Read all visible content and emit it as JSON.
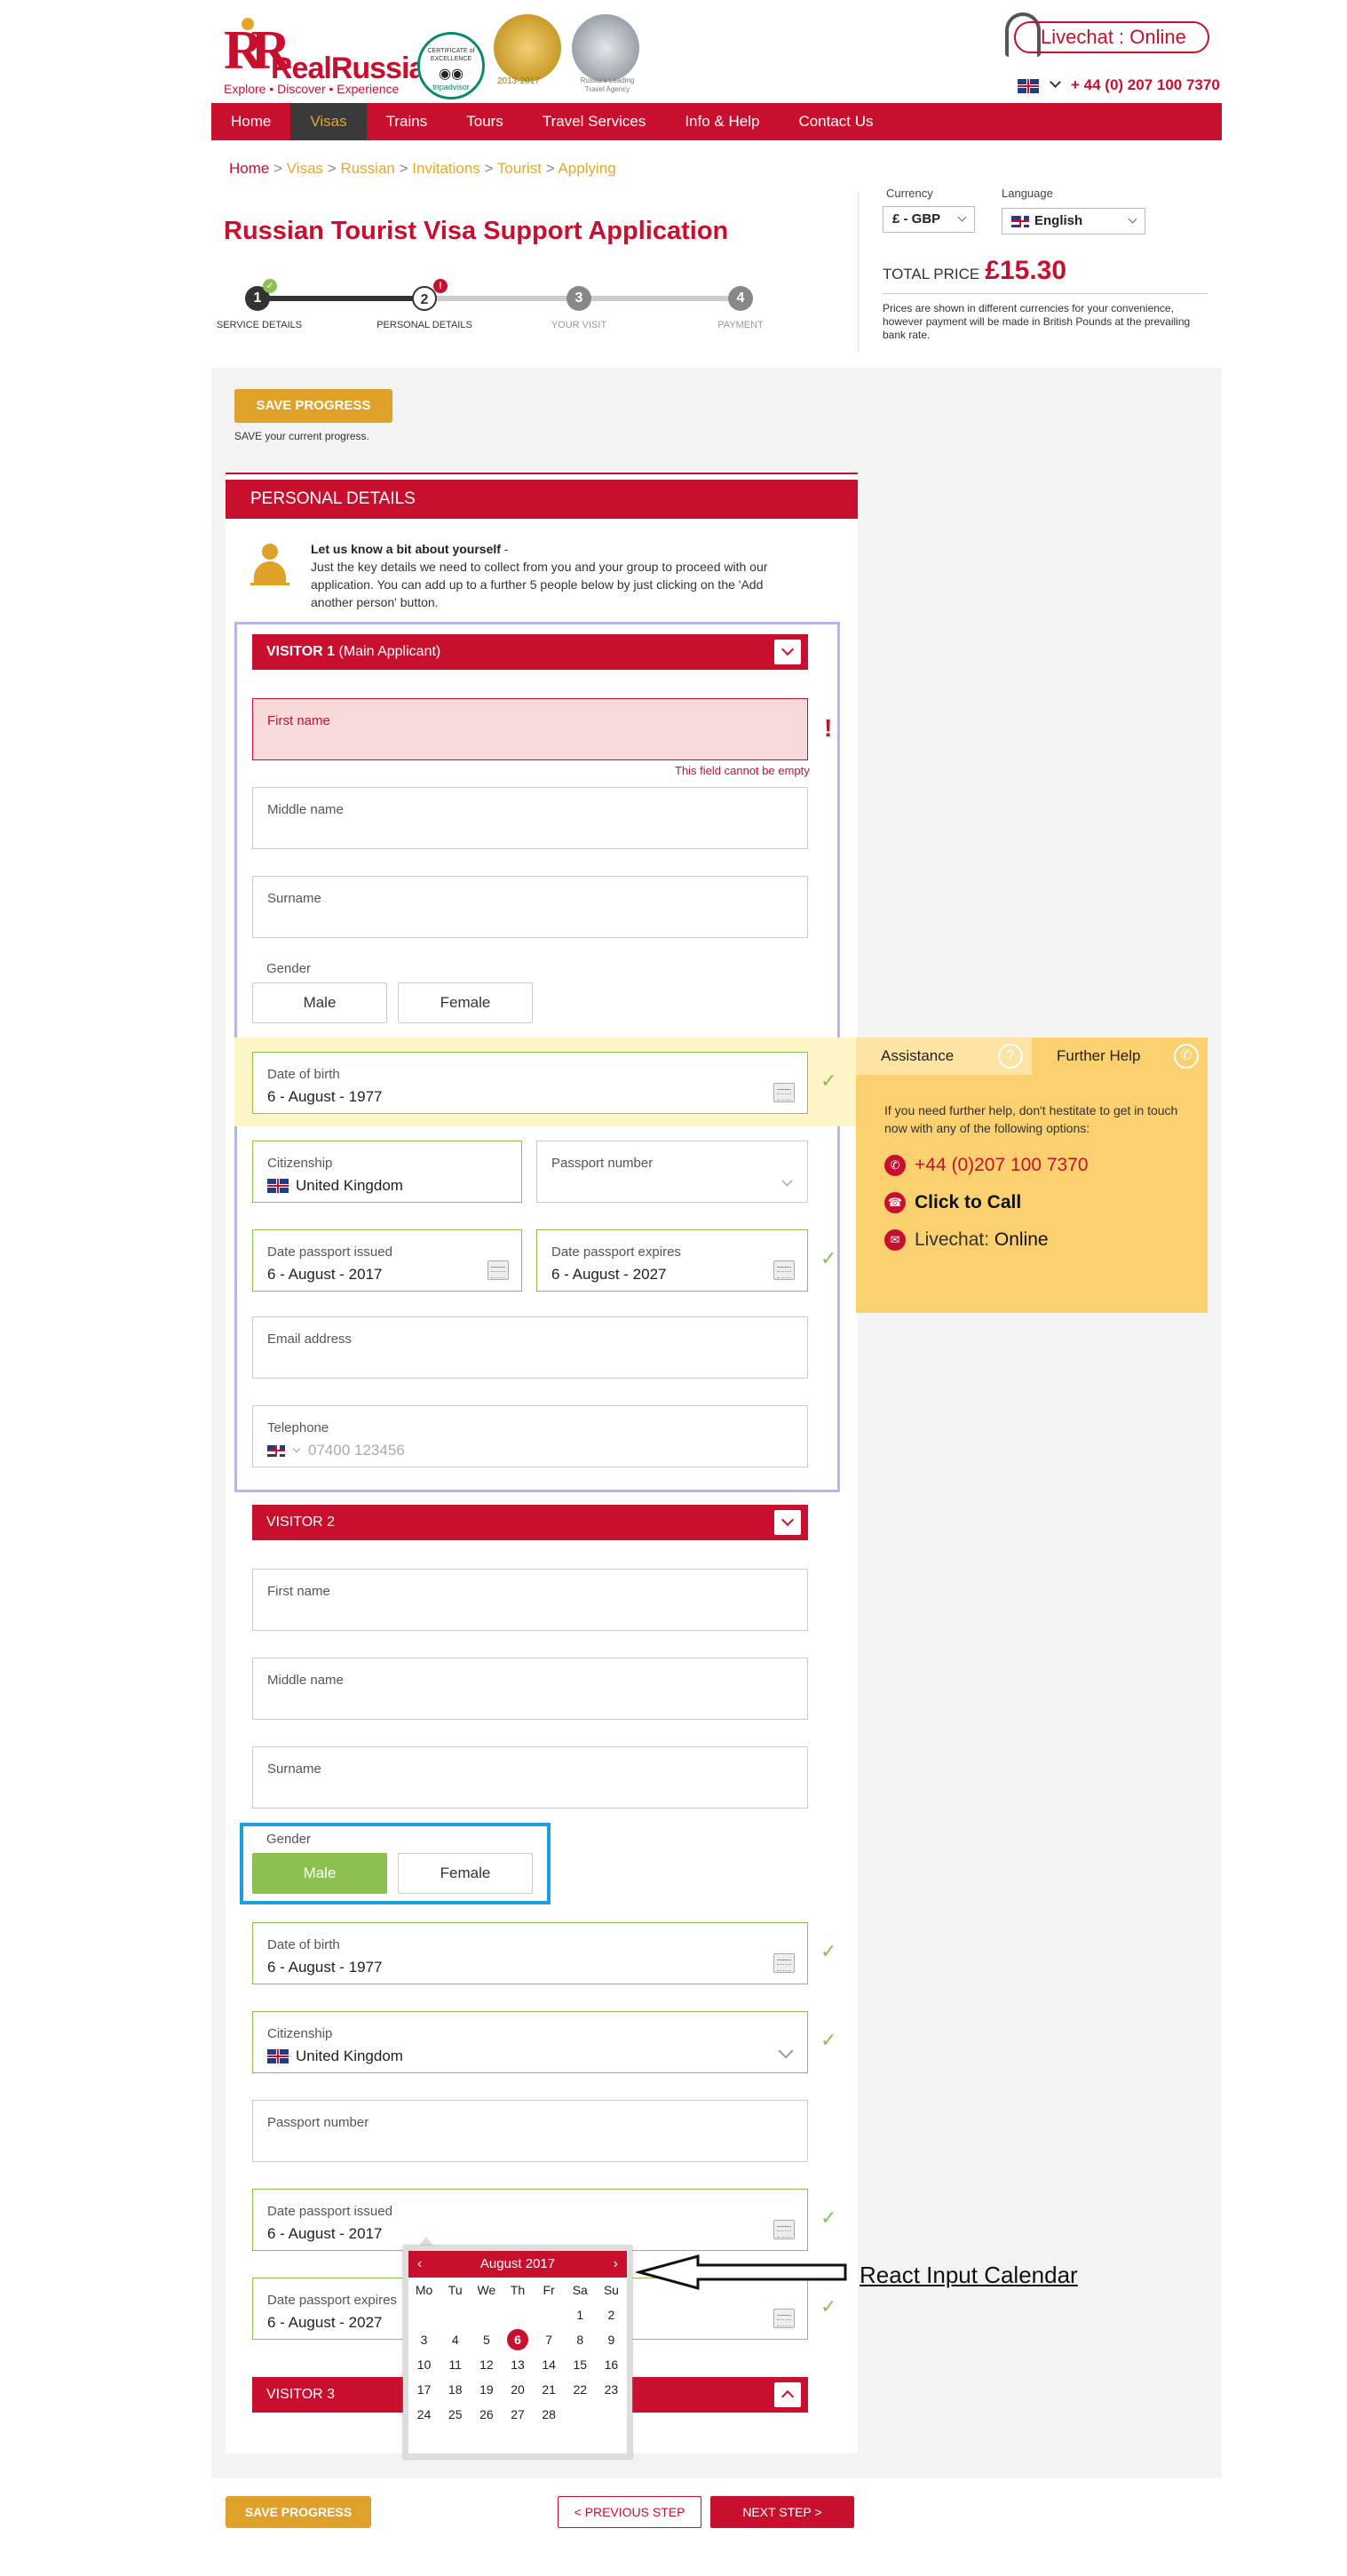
{
  "header": {
    "logo_mark": "RR",
    "logo_name": "RealRussia",
    "logo_tagline": "Explore • Discover • Experience",
    "badge_tripadvisor_top": "CERTIFICATE of EXCELLENCE",
    "badge_tripadvisor_brand": "tripadvisor",
    "badge_award1": "2013-2017",
    "badge_award2": "Russia's Leading Travel Agency",
    "livechat": "Livechat : Online",
    "phone": "+ 44 (0) 207 100 7370"
  },
  "nav": {
    "items": [
      "Home",
      "Visas",
      "Trains",
      "Tours",
      "Travel Services",
      "Info & Help",
      "Contact Us"
    ],
    "active": "Visas"
  },
  "breadcrumb": {
    "home": "Home",
    "sep": ">",
    "items": [
      "Visas",
      "Russian",
      "Invitations",
      "Tourist",
      "Applying"
    ]
  },
  "page": {
    "title": "Russian Tourist Visa Support Application"
  },
  "steps": [
    {
      "num": "1",
      "label": "SERVICE DETAILS",
      "state": "done"
    },
    {
      "num": "2",
      "label": "PERSONAL DETAILS",
      "state": "current",
      "alert": "!"
    },
    {
      "num": "3",
      "label": "YOUR VISIT",
      "state": "todo"
    },
    {
      "num": "4",
      "label": "PAYMENT",
      "state": "todo"
    }
  ],
  "pricing": {
    "currency_label": "Currency",
    "currency_value": "£ - GBP",
    "language_label": "Language",
    "language_value": "English",
    "total_label": "TOTAL PRICE",
    "total_value": "£15.30",
    "note": "Prices are shown in different currencies for your convenience, however payment will be made in British Pounds at the prevailing bank rate."
  },
  "save": {
    "button": "SAVE PROGRESS",
    "note": "SAVE your current progress."
  },
  "personal": {
    "heading": "PERSONAL DETAILS",
    "intro_title": "Let us know a bit about yourself",
    "intro_suffix": " -",
    "intro_body": "Just the key details we need to collect from you and your group to proceed with our application. You can add up to a further 5 people below by just clicking on the 'Add another person' button."
  },
  "visitor1": {
    "title": "VISITOR 1",
    "subtitle": "(Main Applicant)",
    "first_name_label": "First name",
    "first_name_error": "This field cannot be empty",
    "error_mark": "!",
    "middle_name_label": "Middle name",
    "surname_label": "Surname",
    "gender_label": "Gender",
    "gender_male": "Male",
    "gender_female": "Female",
    "dob_label": "Date of birth",
    "dob_value": "6 - August - 1977",
    "citizenship_label": "Citizenship",
    "citizenship_value": "United Kingdom",
    "passport_label": "Passport number",
    "issued_label": "Date passport issued",
    "issued_value": "6 - August - 2017",
    "expires_label": "Date passport expires",
    "expires_value": "6 - August - 2027",
    "email_label": "Email address",
    "phone_label": "Telephone",
    "phone_placeholder": "07400 123456"
  },
  "assistance": {
    "tab1": "Assistance",
    "tab2": "Further Help",
    "help_text": "If you need further help, don't hestitate to get in touch now with any of the following options:",
    "phone": "+44 (0)207 100 7370",
    "call": "Click to Call",
    "livechat_label": "Livechat: ",
    "livechat_status": "Online"
  },
  "visitor2": {
    "title": "VISITOR 2",
    "first_name_label": "First name",
    "middle_name_label": "Middle name",
    "surname_label": "Surname",
    "gender_label": "Gender",
    "gender_male": "Male",
    "gender_female": "Female",
    "gender_selected": "Male",
    "dob_label": "Date of birth",
    "dob_value": "6 - August - 1977",
    "citizenship_label": "Citizenship",
    "citizenship_value": "United Kingdom",
    "passport_label": "Passport number",
    "issued_label": "Date passport issued",
    "issued_value": "6 - August - 2017",
    "expires_label": "Date passport expires",
    "expires_value": "6 - August - 2027"
  },
  "calendar": {
    "month": "August 2017",
    "prev": "‹",
    "next": "›",
    "weekdays": [
      "Mo",
      "Tu",
      "We",
      "Th",
      "Fr",
      "Sa",
      "Su"
    ],
    "weeks": [
      [
        "",
        "",
        "",
        "",
        "",
        "1",
        "2"
      ],
      [
        "3",
        "4",
        "5",
        "6",
        "7",
        "8",
        "9"
      ],
      [
        "10",
        "11",
        "12",
        "13",
        "14",
        "15",
        "16"
      ],
      [
        "17",
        "18",
        "19",
        "20",
        "21",
        "22",
        "23"
      ],
      [
        "24",
        "25",
        "26",
        "27",
        "28",
        "",
        ""
      ]
    ],
    "selected": "6"
  },
  "annotation": "React Input Calendar",
  "visitor3": {
    "title": "VISITOR 3"
  },
  "footer": {
    "save": "SAVE PROGRESS",
    "prev": "< PREVIOUS STEP",
    "next": "NEXT STEP >"
  },
  "colors": {
    "brand_red": "#c8102e",
    "gold": "#e0a12a",
    "success_green": "#8cc152",
    "assist_yellow": "#fbd06e"
  }
}
